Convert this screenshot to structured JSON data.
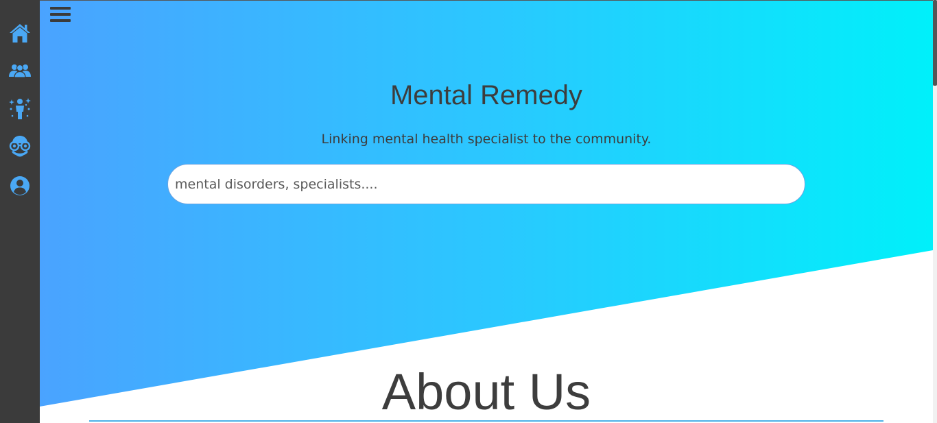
{
  "sidebar": {
    "items": [
      {
        "icon": "home-icon"
      },
      {
        "icon": "users-group-icon"
      },
      {
        "icon": "person-sparkle-icon"
      },
      {
        "icon": "specialist-glasses-icon"
      },
      {
        "icon": "user-circle-icon"
      }
    ],
    "icon_color": "#4aa8f5",
    "background": "#3b3b3b"
  },
  "header": {
    "menu_icon": "hamburger-menu-icon"
  },
  "hero": {
    "title": "Mental Remedy",
    "tagline": "Linking mental health specialist to the community.",
    "gradient": [
      "#4aa3ff",
      "#00f0fa"
    ]
  },
  "search": {
    "placeholder": "mental disorders, specialists....",
    "value": ""
  },
  "about": {
    "title": "About Us"
  }
}
